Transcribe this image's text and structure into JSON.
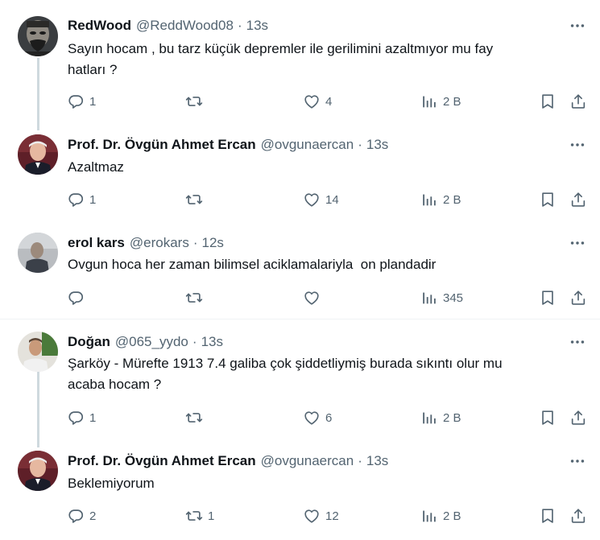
{
  "replies": [
    {
      "name": "RedWood",
      "handle": "@ReddWood08",
      "time": "13s",
      "text": "Sayın hocam , bu tarz küçük depremler ile gerilimini azaltmıyor mu fay\nhatları ?",
      "stats": {
        "replies": "1",
        "retweets": "",
        "likes": "4",
        "views": "2 B"
      }
    },
    {
      "name": "Prof. Dr. Övgün Ahmet Ercan",
      "handle": "@ovgunaercan",
      "time": "13s",
      "text": "Azaltmaz",
      "stats": {
        "replies": "1",
        "retweets": "",
        "likes": "14",
        "views": "2 B"
      }
    },
    {
      "name": "erol kars",
      "handle": "@erokars",
      "time": "12s",
      "text": "Ovgun hoca her zaman bilimsel aciklamalariyla  on plandadir",
      "stats": {
        "replies": "",
        "retweets": "",
        "likes": "",
        "views": "345"
      }
    },
    {
      "name": "Doğan",
      "handle": "@065_yydo",
      "time": "13s",
      "text": "Şarköy - Mürefte 1913 7.4 galiba çok şiddetliymiş burada sıkıntı olur mu\nacaba hocam ?",
      "stats": {
        "replies": "1",
        "retweets": "",
        "likes": "6",
        "views": "2 B"
      }
    },
    {
      "name": "Prof. Dr. Övgün Ahmet Ercan",
      "handle": "@ovgunaercan",
      "time": "13s",
      "text": "Beklemiyorum",
      "stats": {
        "replies": "2",
        "retweets": "1",
        "likes": "12",
        "views": "2 B"
      }
    }
  ],
  "separator": "·",
  "icons": {
    "more": "more-icon",
    "reply": "reply-icon",
    "retweet": "retweet-icon",
    "like": "like-icon",
    "views": "views-icon",
    "bookmark": "bookmark-icon",
    "share": "share-icon"
  },
  "colors": {
    "text": "#0f1419",
    "secondary": "#536471",
    "thread_line": "#cfd9de",
    "divider": "#eff3f4"
  }
}
